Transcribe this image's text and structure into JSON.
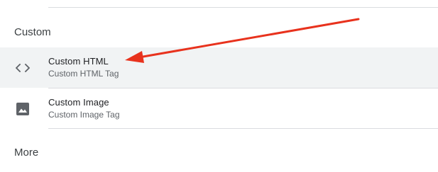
{
  "sections": {
    "custom": {
      "header": "Custom",
      "items": [
        {
          "title": "Custom HTML",
          "subtitle": "Custom HTML Tag",
          "icon": "code-brackets-icon"
        },
        {
          "title": "Custom Image",
          "subtitle": "Custom Image Tag",
          "icon": "image-icon"
        }
      ]
    },
    "more": {
      "header": "More"
    }
  },
  "colors": {
    "highlight_row": "#f1f3f4",
    "annotation_arrow": "#e8321d",
    "icon": "#5f6368",
    "divider": "#dadce0"
  }
}
